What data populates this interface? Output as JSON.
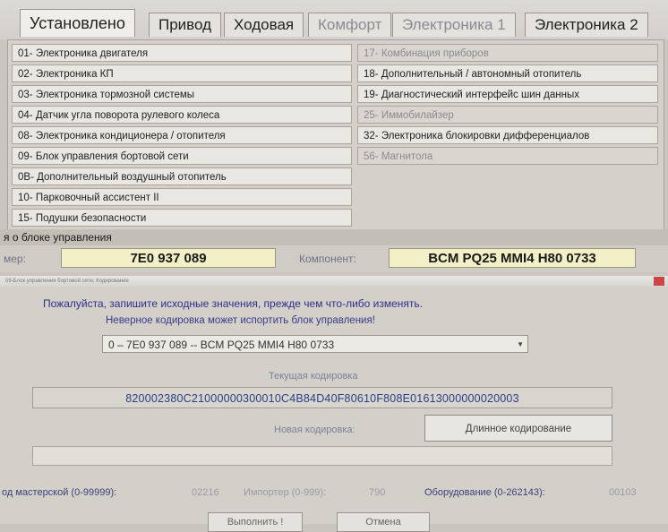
{
  "tabs": [
    {
      "label": "Установлено"
    },
    {
      "label": "Привод"
    },
    {
      "label": "Ходовая"
    },
    {
      "label": "Комфорт"
    },
    {
      "label": "Электроника 1"
    },
    {
      "label": "Электроника 2"
    }
  ],
  "modules_left": [
    "01- Электроника двигателя",
    "02- Электроника КП",
    "03- Электроника тормозной системы",
    "04- Датчик угла поворота рулевого колеса",
    "08- Электроника кондиционера / отопителя",
    "09- Блок управления бортовой сети",
    "0B- Дополнительный воздушный отопитель",
    "10- Парковочный ассистент II",
    "15- Подушки безопасности"
  ],
  "modules_right": [
    "17- Комбинация приборов",
    "18- Дополнительный / автономный отопитель",
    "19- Диагностический интерфейс шин данных",
    "25- Иммобилайзер",
    "32- Электроника блокировки дифференциалов",
    "56- Магнитола"
  ],
  "info": {
    "header": "я о блоке управления",
    "part_label": "мер:",
    "part_number": "7E0 937 089",
    "component_label": "Компонент:",
    "component_value": "BCM PQ25 MMI4 H80 0733"
  },
  "dialog": {
    "title": "09-Блок управления бортовой сети, Кодирование",
    "message1": "Пожалуйста, запишите исходные значения, прежде чем что-либо изменять.",
    "message2": "Неверное кодировка может испортить блок управления!",
    "select_value": "0 – 7E0 937 089 -- BCM PQ25 MMI4 H80 0733",
    "current_coding_label": "Текущая кодировка",
    "current_coding": "820002380C21000000300010C4B84D40F80610F808E01613000000020003",
    "new_coding_label": "Новая кодировка:",
    "long_coding_button": "Длинное кодирование",
    "new_coding_value": "",
    "workshop_label": "од мастерской (0-99999):",
    "workshop_value": "02216",
    "importer_label": "Импортер (0-999):",
    "importer_value": "790",
    "equipment_label": "Оборудование (0-262143):",
    "equipment_value": "00103",
    "button_do": "Выполнить !",
    "button_cancel": "Отмена"
  },
  "colors": {
    "value_box": "#f3efc6",
    "coding_text": "#2b3f86",
    "message_text": "#2b2f8c"
  }
}
